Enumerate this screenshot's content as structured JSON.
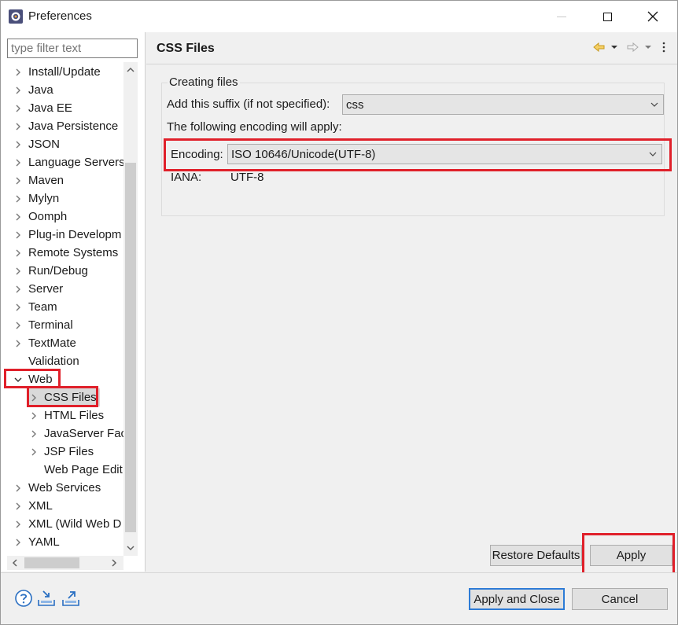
{
  "window": {
    "title": "Preferences"
  },
  "filter": {
    "placeholder": "type filter text"
  },
  "tree": [
    {
      "label": "Install/Update",
      "level": 0,
      "state": "collapsed"
    },
    {
      "label": "Java",
      "level": 0,
      "state": "collapsed"
    },
    {
      "label": "Java EE",
      "level": 0,
      "state": "collapsed"
    },
    {
      "label": "Java Persistence",
      "level": 0,
      "state": "collapsed"
    },
    {
      "label": "JSON",
      "level": 0,
      "state": "collapsed"
    },
    {
      "label": "Language Servers",
      "level": 0,
      "state": "collapsed"
    },
    {
      "label": "Maven",
      "level": 0,
      "state": "collapsed"
    },
    {
      "label": "Mylyn",
      "level": 0,
      "state": "collapsed"
    },
    {
      "label": "Oomph",
      "level": 0,
      "state": "collapsed"
    },
    {
      "label": "Plug-in Developm",
      "level": 0,
      "state": "collapsed"
    },
    {
      "label": "Remote Systems",
      "level": 0,
      "state": "collapsed"
    },
    {
      "label": "Run/Debug",
      "level": 0,
      "state": "collapsed"
    },
    {
      "label": "Server",
      "level": 0,
      "state": "collapsed"
    },
    {
      "label": "Team",
      "level": 0,
      "state": "collapsed"
    },
    {
      "label": "Terminal",
      "level": 0,
      "state": "collapsed"
    },
    {
      "label": "TextMate",
      "level": 0,
      "state": "collapsed"
    },
    {
      "label": "Validation",
      "level": 0,
      "state": "leaf"
    },
    {
      "label": "Web",
      "level": 0,
      "state": "expanded"
    },
    {
      "label": "CSS Files",
      "level": 1,
      "state": "collapsed",
      "selected": true
    },
    {
      "label": "HTML Files",
      "level": 1,
      "state": "collapsed"
    },
    {
      "label": "JavaServer Face",
      "level": 1,
      "state": "collapsed"
    },
    {
      "label": "JSP Files",
      "level": 1,
      "state": "collapsed"
    },
    {
      "label": "Web Page Edit",
      "level": 1,
      "state": "leaf"
    },
    {
      "label": "Web Services",
      "level": 0,
      "state": "collapsed"
    },
    {
      "label": "XML",
      "level": 0,
      "state": "collapsed"
    },
    {
      "label": "XML (Wild Web D",
      "level": 0,
      "state": "collapsed"
    },
    {
      "label": "YAML",
      "level": 0,
      "state": "collapsed"
    }
  ],
  "page": {
    "title": "CSS Files",
    "group_label": "Creating files",
    "suffix_label": "Add this suffix (if not specified):",
    "suffix_value": "css",
    "encoding_note": "The following encoding will apply:",
    "encoding_label": "Encoding:",
    "encoding_value": "ISO 10646/Unicode(UTF-8)",
    "iana_label": "IANA:",
    "iana_value": "UTF-8",
    "restore_label": "Restore Defaults",
    "apply_label": "Apply"
  },
  "footer": {
    "apply_close_label": "Apply and Close",
    "cancel_label": "Cancel"
  },
  "colors": {
    "highlight": "#e0202a",
    "focus": "#2d7bd6",
    "icon_blue": "#2a6fc2"
  }
}
